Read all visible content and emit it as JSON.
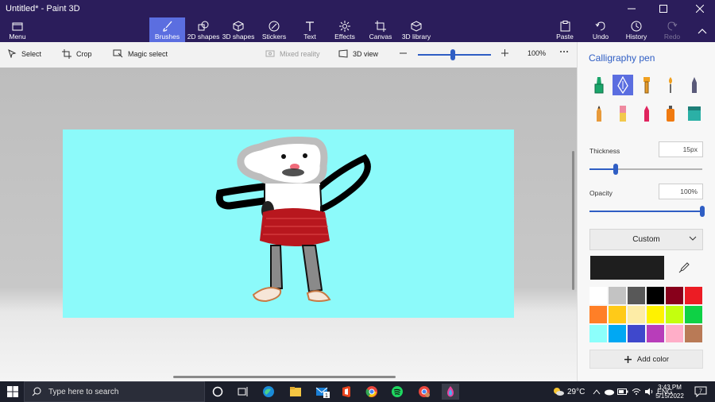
{
  "window": {
    "title": "Untitled* - Paint 3D"
  },
  "ribbon": {
    "menu_label": "Menu",
    "tools": [
      {
        "label": "Brushes",
        "icon": "brush-icon",
        "active": true
      },
      {
        "label": "2D shapes",
        "icon": "2d-shapes-icon"
      },
      {
        "label": "3D shapes",
        "icon": "3d-shapes-icon"
      },
      {
        "label": "Stickers",
        "icon": "stickers-icon"
      },
      {
        "label": "Text",
        "icon": "text-icon"
      },
      {
        "label": "Effects",
        "icon": "effects-icon"
      },
      {
        "label": "Canvas",
        "icon": "canvas-icon"
      },
      {
        "label": "3D library",
        "icon": "3d-library-icon"
      }
    ],
    "right_tools": [
      {
        "label": "Paste",
        "icon": "paste-icon"
      },
      {
        "label": "Undo",
        "icon": "undo-icon"
      },
      {
        "label": "History",
        "icon": "history-icon"
      },
      {
        "label": "Redo",
        "icon": "redo-icon",
        "disabled": true
      }
    ]
  },
  "subbar": {
    "select_label": "Select",
    "crop_label": "Crop",
    "magic_select_label": "Magic select",
    "mixed_reality_label": "Mixed reality",
    "view_3d_label": "3D view",
    "zoom_value": "100%",
    "zoom_level": 0.34
  },
  "panel": {
    "title": "Calligraphy pen",
    "brushes": [
      {
        "name": "marker-icon",
        "color": "#1aa56a"
      },
      {
        "name": "calligraphy-pen-icon",
        "color": "#ffffff",
        "active": true
      },
      {
        "name": "oil-brush-icon",
        "color": "#f0a020"
      },
      {
        "name": "watercolor-icon",
        "color": "#f0a020"
      },
      {
        "name": "pixel-pen-icon",
        "color": "#5a5a7a"
      },
      {
        "name": "pencil-icon",
        "color": "#e89a3a"
      },
      {
        "name": "eraser-icon",
        "color": "#ef8aa0"
      },
      {
        "name": "crayon-icon",
        "color": "#e0245e"
      },
      {
        "name": "spray-can-icon",
        "color": "#f07a10"
      },
      {
        "name": "fill-icon",
        "color": "#2bb0a6"
      }
    ],
    "thickness_label": "Thickness",
    "thickness_value": "15px",
    "thickness_level": 0.23,
    "opacity_label": "Opacity",
    "opacity_value": "100%",
    "opacity_level": 1.0,
    "color_mode": "Custom",
    "current_color": "#1e1e1e",
    "palette": [
      "#ffffff",
      "#c3c3c3",
      "#585858",
      "#000000",
      "#88001b",
      "#ec1c24",
      "#ff7f27",
      "#ffca18",
      "#fdeca6",
      "#fff200",
      "#c4ff0e",
      "#0ed145",
      "#8cfffb",
      "#00a8f3",
      "#3f48cc",
      "#b83dba",
      "#ffaec8",
      "#b97a56"
    ],
    "add_color_label": "Add color"
  },
  "taskbar": {
    "search_placeholder": "Type here to search",
    "weather": "29°C",
    "time": "3:43 PM",
    "date": "5/15/2022",
    "mail_badge": "1",
    "notification_badge": "7"
  },
  "colors": {
    "ribbon_bg": "#2b1d5b",
    "accent": "#5b6ee0",
    "link_blue": "#2f5ec4",
    "canvas_bg": "#8cfafa"
  }
}
